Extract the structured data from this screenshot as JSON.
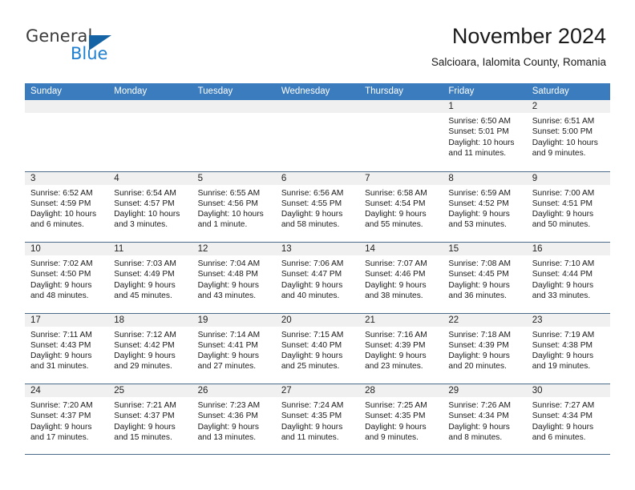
{
  "brand": {
    "name_top": "General",
    "name_bottom": "Blue",
    "triangle_icon": "triangle-icon",
    "accent_color": "#1f7fd0",
    "triangle_color": "#1464a5"
  },
  "header": {
    "month_title": "November 2024",
    "location": "Salcioara, Ialomita County, Romania"
  },
  "calendar": {
    "header_bg_color": "#3b7cbe",
    "day_strip_color": "#f0f0f0",
    "weekdays": [
      "Sunday",
      "Monday",
      "Tuesday",
      "Wednesday",
      "Thursday",
      "Friday",
      "Saturday"
    ],
    "weeks": [
      [
        {
          "day": "",
          "sunrise": "",
          "sunset": "",
          "daylight_line1": "",
          "daylight_line2": ""
        },
        {
          "day": "",
          "sunrise": "",
          "sunset": "",
          "daylight_line1": "",
          "daylight_line2": ""
        },
        {
          "day": "",
          "sunrise": "",
          "sunset": "",
          "daylight_line1": "",
          "daylight_line2": ""
        },
        {
          "day": "",
          "sunrise": "",
          "sunset": "",
          "daylight_line1": "",
          "daylight_line2": ""
        },
        {
          "day": "",
          "sunrise": "",
          "sunset": "",
          "daylight_line1": "",
          "daylight_line2": ""
        },
        {
          "day": "1",
          "sunrise": "Sunrise: 6:50 AM",
          "sunset": "Sunset: 5:01 PM",
          "daylight_line1": "Daylight: 10 hours",
          "daylight_line2": "and 11 minutes."
        },
        {
          "day": "2",
          "sunrise": "Sunrise: 6:51 AM",
          "sunset": "Sunset: 5:00 PM",
          "daylight_line1": "Daylight: 10 hours",
          "daylight_line2": "and 9 minutes."
        }
      ],
      [
        {
          "day": "3",
          "sunrise": "Sunrise: 6:52 AM",
          "sunset": "Sunset: 4:59 PM",
          "daylight_line1": "Daylight: 10 hours",
          "daylight_line2": "and 6 minutes."
        },
        {
          "day": "4",
          "sunrise": "Sunrise: 6:54 AM",
          "sunset": "Sunset: 4:57 PM",
          "daylight_line1": "Daylight: 10 hours",
          "daylight_line2": "and 3 minutes."
        },
        {
          "day": "5",
          "sunrise": "Sunrise: 6:55 AM",
          "sunset": "Sunset: 4:56 PM",
          "daylight_line1": "Daylight: 10 hours",
          "daylight_line2": "and 1 minute."
        },
        {
          "day": "6",
          "sunrise": "Sunrise: 6:56 AM",
          "sunset": "Sunset: 4:55 PM",
          "daylight_line1": "Daylight: 9 hours",
          "daylight_line2": "and 58 minutes."
        },
        {
          "day": "7",
          "sunrise": "Sunrise: 6:58 AM",
          "sunset": "Sunset: 4:54 PM",
          "daylight_line1": "Daylight: 9 hours",
          "daylight_line2": "and 55 minutes."
        },
        {
          "day": "8",
          "sunrise": "Sunrise: 6:59 AM",
          "sunset": "Sunset: 4:52 PM",
          "daylight_line1": "Daylight: 9 hours",
          "daylight_line2": "and 53 minutes."
        },
        {
          "day": "9",
          "sunrise": "Sunrise: 7:00 AM",
          "sunset": "Sunset: 4:51 PM",
          "daylight_line1": "Daylight: 9 hours",
          "daylight_line2": "and 50 minutes."
        }
      ],
      [
        {
          "day": "10",
          "sunrise": "Sunrise: 7:02 AM",
          "sunset": "Sunset: 4:50 PM",
          "daylight_line1": "Daylight: 9 hours",
          "daylight_line2": "and 48 minutes."
        },
        {
          "day": "11",
          "sunrise": "Sunrise: 7:03 AM",
          "sunset": "Sunset: 4:49 PM",
          "daylight_line1": "Daylight: 9 hours",
          "daylight_line2": "and 45 minutes."
        },
        {
          "day": "12",
          "sunrise": "Sunrise: 7:04 AM",
          "sunset": "Sunset: 4:48 PM",
          "daylight_line1": "Daylight: 9 hours",
          "daylight_line2": "and 43 minutes."
        },
        {
          "day": "13",
          "sunrise": "Sunrise: 7:06 AM",
          "sunset": "Sunset: 4:47 PM",
          "daylight_line1": "Daylight: 9 hours",
          "daylight_line2": "and 40 minutes."
        },
        {
          "day": "14",
          "sunrise": "Sunrise: 7:07 AM",
          "sunset": "Sunset: 4:46 PM",
          "daylight_line1": "Daylight: 9 hours",
          "daylight_line2": "and 38 minutes."
        },
        {
          "day": "15",
          "sunrise": "Sunrise: 7:08 AM",
          "sunset": "Sunset: 4:45 PM",
          "daylight_line1": "Daylight: 9 hours",
          "daylight_line2": "and 36 minutes."
        },
        {
          "day": "16",
          "sunrise": "Sunrise: 7:10 AM",
          "sunset": "Sunset: 4:44 PM",
          "daylight_line1": "Daylight: 9 hours",
          "daylight_line2": "and 33 minutes."
        }
      ],
      [
        {
          "day": "17",
          "sunrise": "Sunrise: 7:11 AM",
          "sunset": "Sunset: 4:43 PM",
          "daylight_line1": "Daylight: 9 hours",
          "daylight_line2": "and 31 minutes."
        },
        {
          "day": "18",
          "sunrise": "Sunrise: 7:12 AM",
          "sunset": "Sunset: 4:42 PM",
          "daylight_line1": "Daylight: 9 hours",
          "daylight_line2": "and 29 minutes."
        },
        {
          "day": "19",
          "sunrise": "Sunrise: 7:14 AM",
          "sunset": "Sunset: 4:41 PM",
          "daylight_line1": "Daylight: 9 hours",
          "daylight_line2": "and 27 minutes."
        },
        {
          "day": "20",
          "sunrise": "Sunrise: 7:15 AM",
          "sunset": "Sunset: 4:40 PM",
          "daylight_line1": "Daylight: 9 hours",
          "daylight_line2": "and 25 minutes."
        },
        {
          "day": "21",
          "sunrise": "Sunrise: 7:16 AM",
          "sunset": "Sunset: 4:39 PM",
          "daylight_line1": "Daylight: 9 hours",
          "daylight_line2": "and 23 minutes."
        },
        {
          "day": "22",
          "sunrise": "Sunrise: 7:18 AM",
          "sunset": "Sunset: 4:39 PM",
          "daylight_line1": "Daylight: 9 hours",
          "daylight_line2": "and 20 minutes."
        },
        {
          "day": "23",
          "sunrise": "Sunrise: 7:19 AM",
          "sunset": "Sunset: 4:38 PM",
          "daylight_line1": "Daylight: 9 hours",
          "daylight_line2": "and 19 minutes."
        }
      ],
      [
        {
          "day": "24",
          "sunrise": "Sunrise: 7:20 AM",
          "sunset": "Sunset: 4:37 PM",
          "daylight_line1": "Daylight: 9 hours",
          "daylight_line2": "and 17 minutes."
        },
        {
          "day": "25",
          "sunrise": "Sunrise: 7:21 AM",
          "sunset": "Sunset: 4:37 PM",
          "daylight_line1": "Daylight: 9 hours",
          "daylight_line2": "and 15 minutes."
        },
        {
          "day": "26",
          "sunrise": "Sunrise: 7:23 AM",
          "sunset": "Sunset: 4:36 PM",
          "daylight_line1": "Daylight: 9 hours",
          "daylight_line2": "and 13 minutes."
        },
        {
          "day": "27",
          "sunrise": "Sunrise: 7:24 AM",
          "sunset": "Sunset: 4:35 PM",
          "daylight_line1": "Daylight: 9 hours",
          "daylight_line2": "and 11 minutes."
        },
        {
          "day": "28",
          "sunrise": "Sunrise: 7:25 AM",
          "sunset": "Sunset: 4:35 PM",
          "daylight_line1": "Daylight: 9 hours",
          "daylight_line2": "and 9 minutes."
        },
        {
          "day": "29",
          "sunrise": "Sunrise: 7:26 AM",
          "sunset": "Sunset: 4:34 PM",
          "daylight_line1": "Daylight: 9 hours",
          "daylight_line2": "and 8 minutes."
        },
        {
          "day": "30",
          "sunrise": "Sunrise: 7:27 AM",
          "sunset": "Sunset: 4:34 PM",
          "daylight_line1": "Daylight: 9 hours",
          "daylight_line2": "and 6 minutes."
        }
      ]
    ]
  }
}
